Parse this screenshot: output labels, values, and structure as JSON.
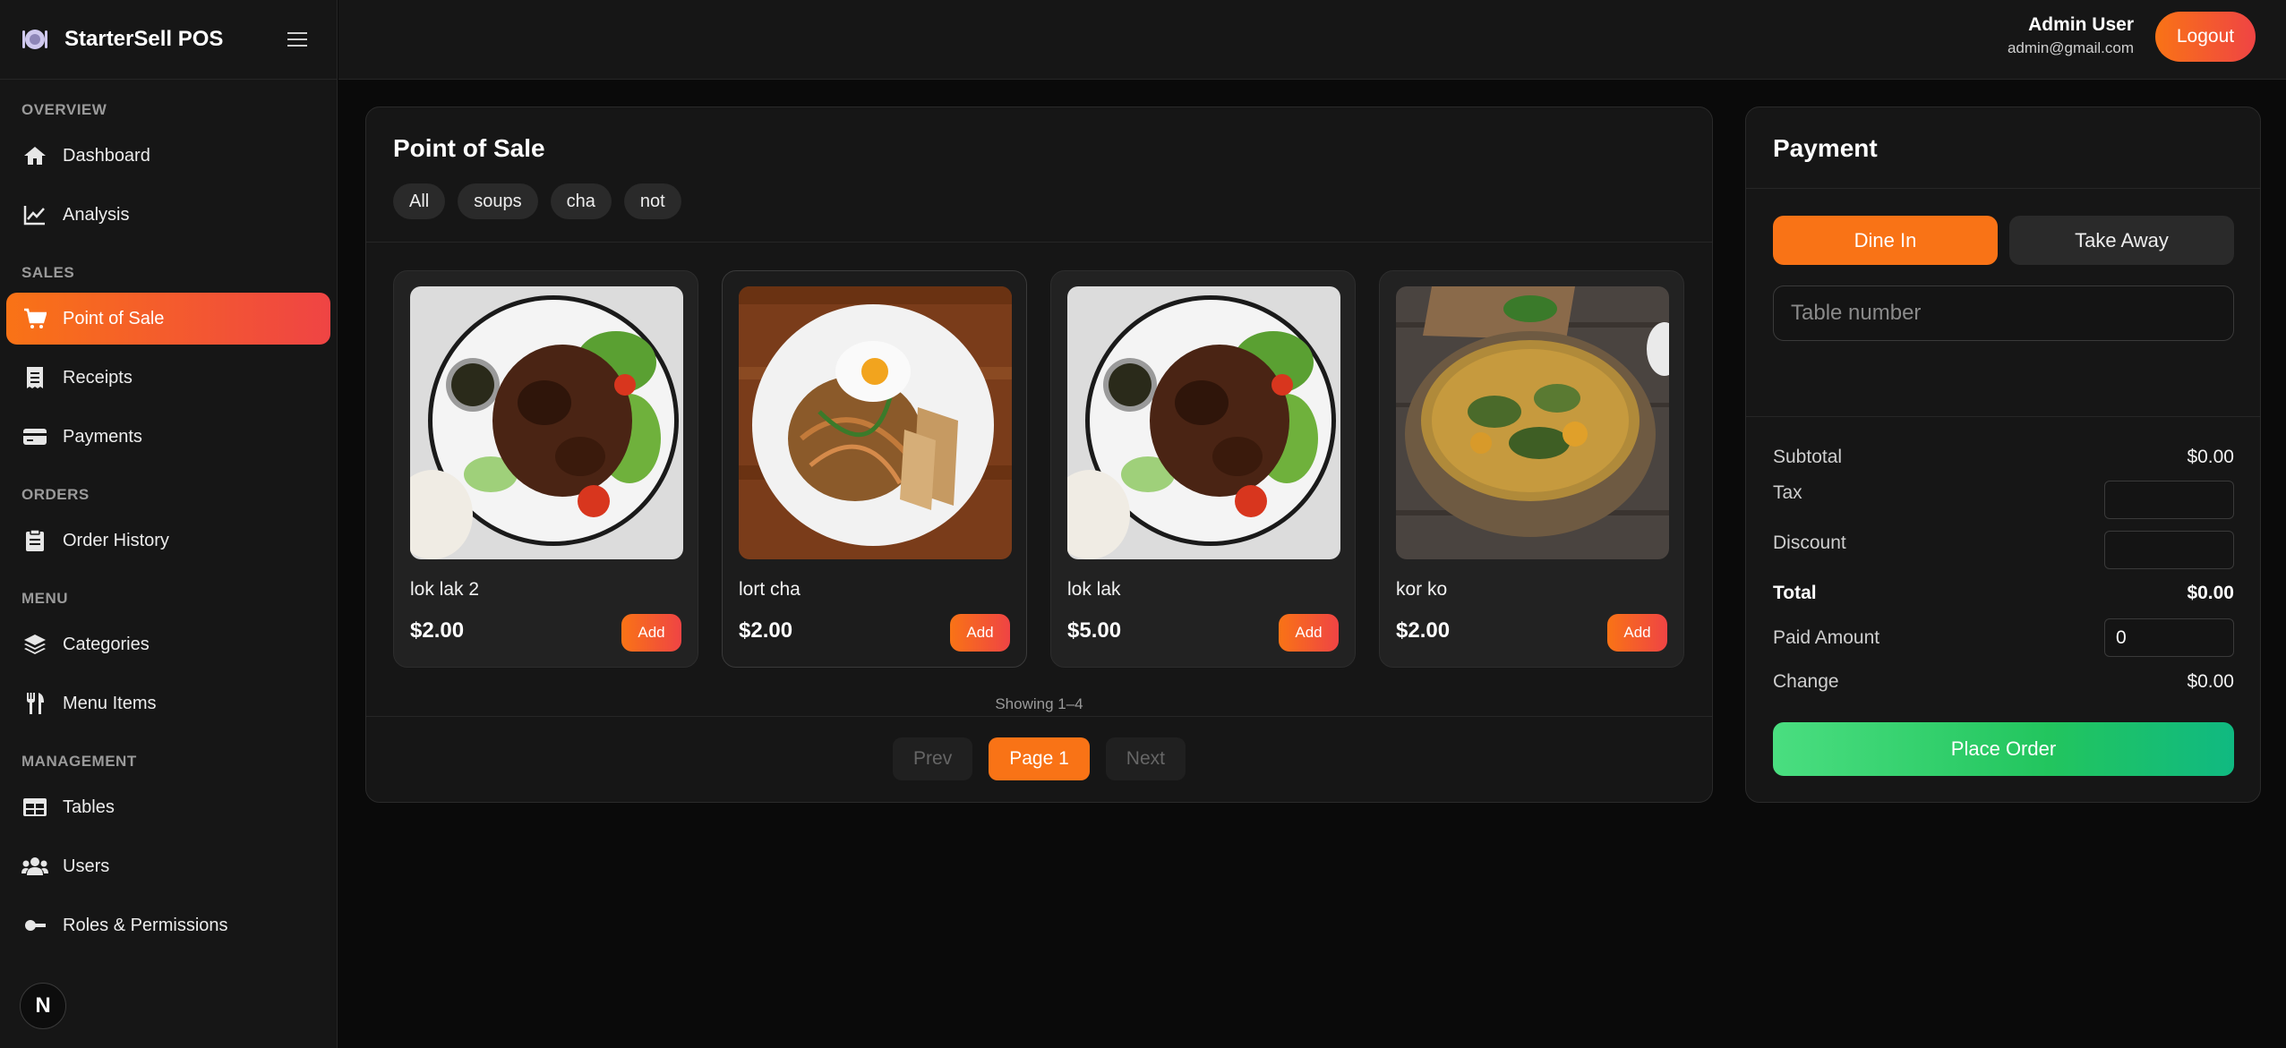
{
  "brand": {
    "name": "StarterSell POS"
  },
  "sidebar": {
    "sections": [
      {
        "title": "OVERVIEW",
        "items": [
          {
            "label": "Dashboard",
            "icon": "home-icon"
          },
          {
            "label": "Analysis",
            "icon": "chart-line-icon"
          }
        ]
      },
      {
        "title": "SALES",
        "items": [
          {
            "label": "Point of Sale",
            "icon": "cart-icon",
            "active": true
          },
          {
            "label": "Receipts",
            "icon": "receipt-icon"
          },
          {
            "label": "Payments",
            "icon": "credit-card-icon"
          }
        ]
      },
      {
        "title": "ORDERS",
        "items": [
          {
            "label": "Order History",
            "icon": "clipboard-icon"
          }
        ]
      },
      {
        "title": "MENU",
        "items": [
          {
            "label": "Categories",
            "icon": "layers-icon"
          },
          {
            "label": "Menu Items",
            "icon": "utensils-icon"
          }
        ]
      },
      {
        "title": "MANAGEMENT",
        "items": [
          {
            "label": "Tables",
            "icon": "table-icon"
          },
          {
            "label": "Users",
            "icon": "users-icon"
          },
          {
            "label": "Roles & Permissions",
            "icon": "key-icon"
          }
        ]
      }
    ],
    "fab_label": "N"
  },
  "header": {
    "user_name": "Admin User",
    "user_email": "admin@gmail.com",
    "logout_label": "Logout"
  },
  "pos": {
    "title": "Point of Sale",
    "categories": [
      "All",
      "soups",
      "cha",
      "not"
    ],
    "products": [
      {
        "name": "lok lak 2",
        "price": "$2.00",
        "add_label": "Add",
        "image": "beef-plate"
      },
      {
        "name": "lort cha",
        "price": "$2.00",
        "add_label": "Add",
        "image": "noodle-plate"
      },
      {
        "name": "lok lak",
        "price": "$5.00",
        "add_label": "Add",
        "image": "beef-plate"
      },
      {
        "name": "kor ko",
        "price": "$2.00",
        "add_label": "Add",
        "image": "soup-bowl"
      }
    ],
    "showing": "Showing 1–4",
    "pagination": {
      "prev": "Prev",
      "current": "Page 1",
      "next": "Next"
    }
  },
  "payment": {
    "title": "Payment",
    "dine_in": "Dine In",
    "take_away": "Take Away",
    "table_placeholder": "Table number",
    "subtotal_label": "Subtotal",
    "subtotal_value": "$0.00",
    "tax_label": "Tax",
    "tax_value": "",
    "discount_label": "Discount",
    "discount_value": "",
    "total_label": "Total",
    "total_value": "$0.00",
    "paid_label": "Paid Amount",
    "paid_value": "0",
    "change_label": "Change",
    "change_value": "$0.00",
    "place_order": "Place Order"
  },
  "colors": {
    "accent": "#f97316",
    "accent_end": "#ef4444",
    "success": "#22c55e",
    "bg": "#0a0a0a",
    "panel": "#161616"
  }
}
